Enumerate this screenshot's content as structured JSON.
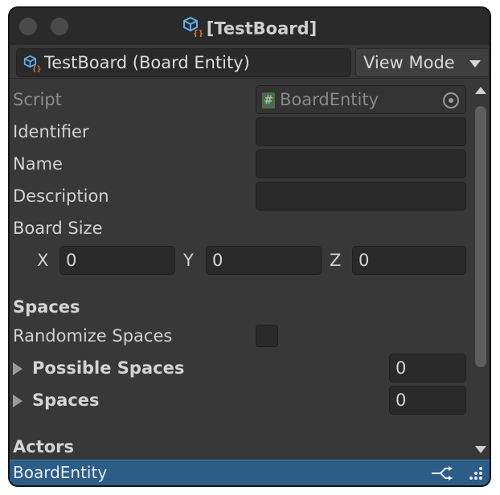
{
  "window": {
    "title": "[TestBoard]"
  },
  "header": {
    "object_label": "TestBoard (Board Entity)",
    "view_mode_label": "View Mode"
  },
  "fields": {
    "script_label": "Script",
    "script_value": "BoardEntity",
    "identifier_label": "Identifier",
    "identifier_value": "",
    "name_label": "Name",
    "name_value": "",
    "description_label": "Description",
    "description_value": "",
    "board_size_label": "Board Size",
    "x_label": "X",
    "x_value": "0",
    "y_label": "Y",
    "y_value": "0",
    "z_label": "Z",
    "z_value": "0"
  },
  "spaces": {
    "heading": "Spaces",
    "randomize_label": "Randomize Spaces",
    "randomize_checked": false,
    "possible_label": "Possible Spaces",
    "possible_count": "0",
    "spaces_label": "Spaces",
    "spaces_count": "0"
  },
  "actors": {
    "heading": "Actors"
  },
  "status": {
    "label": "BoardEntity"
  },
  "colors": {
    "background": "#383838",
    "titlebar": "#2a2a2a",
    "status_bar": "#2c5d87",
    "icon_cube": "#5bb5e8",
    "icon_braces": "#e8743b"
  },
  "icons": [
    "cube-script-icon",
    "script-hash-icon",
    "object-picker-icon",
    "foldout-arrow-icon",
    "scroll-up-icon",
    "scroll-down-icon",
    "connect-icon",
    "resize-grip-icon"
  ]
}
